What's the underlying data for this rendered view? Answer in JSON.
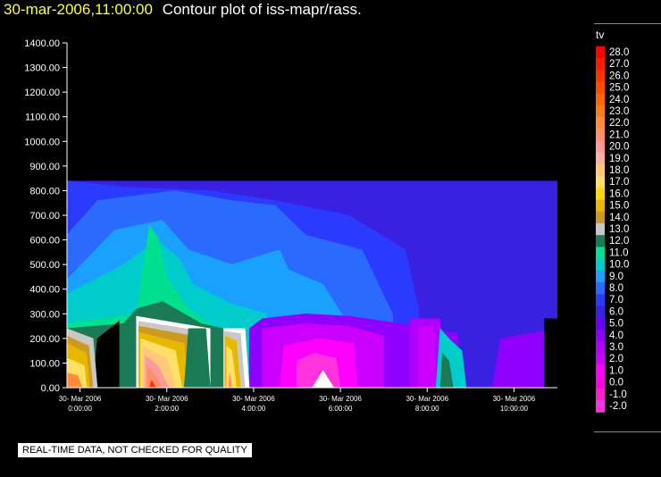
{
  "title": {
    "timestamp": "30-mar-2006,11:00:00",
    "text": "Contour plot of iss-mapr/rass."
  },
  "legend": {
    "title": "tv",
    "entries": [
      "28.0",
      "27.0",
      "26.0",
      "25.0",
      "24.0",
      "23.0",
      "22.0",
      "21.0",
      "20.0",
      "19.0",
      "18.0",
      "17.0",
      "16.0",
      "15.0",
      "14.0",
      "13.0",
      "12.0",
      "11.0",
      "10.0",
      "9.0",
      "8.0",
      "7.0",
      "6.0",
      "5.0",
      "4.0",
      "3.0",
      "2.0",
      "1.0",
      "0.0",
      "-1.0",
      "-2.0"
    ],
    "colors": [
      "#ff0000",
      "#ff1a00",
      "#ff3300",
      "#ff4d00",
      "#ff6600",
      "#ff7a1a",
      "#ff8c3a",
      "#ff8f6a",
      "#ff9a9a",
      "#ffb0a0",
      "#ffc87a",
      "#ffe066",
      "#ffd700",
      "#e8b800",
      "#cc9a22",
      "#c8c8c8",
      "#1a7a55",
      "#00e090",
      "#00cccc",
      "#1aa0ff",
      "#2a6aff",
      "#2a3aff",
      "#3a20e0",
      "#6600ff",
      "#9000ff",
      "#b000ff",
      "#cc00ff",
      "#ff00ff",
      "#ff00dd",
      "#ff22cc",
      "#ff33dd"
    ]
  },
  "note": "REAL-TIME DATA, NOT CHECKED FOR QUALITY",
  "chart_data": {
    "type": "heatmap",
    "title": "Contour plot of iss-mapr/rass.",
    "ylim": [
      0,
      1400
    ],
    "yticks": [
      "1400.00",
      "1300.00",
      "1200.00",
      "1100.00",
      "1000.00",
      "900.00",
      "800.00",
      "700.00",
      "600.00",
      "500.00",
      "400.00",
      "300.00",
      "200.00",
      "100.00",
      "0.00"
    ],
    "xlim": [
      -0.3,
      11.0
    ],
    "xticks": [
      {
        "hour": 0,
        "date": "30- Mar 2006",
        "time": "0:00:00"
      },
      {
        "hour": 2,
        "date": "30- Mar 2006",
        "time": "2:00:00"
      },
      {
        "hour": 4,
        "date": "30- Mar 2006",
        "time": "4:00:00"
      },
      {
        "hour": 6,
        "date": "30- Mar 2006",
        "time": "6:00:00"
      },
      {
        "hour": 8,
        "date": "30- Mar 2006",
        "time": "8:00:00"
      },
      {
        "hour": 10,
        "date": "30- Mar 2006",
        "time": "10:00:00"
      }
    ],
    "regions": [
      {
        "fill": "#3a20e0",
        "points": [
          [
            -0.3,
            0
          ],
          [
            11.5,
            0
          ],
          [
            11.5,
            840
          ],
          [
            -0.3,
            840
          ]
        ]
      },
      {
        "fill": "#2a3aff",
        "points": [
          [
            -0.3,
            0
          ],
          [
            8,
            0
          ],
          [
            7.8,
            320
          ],
          [
            7.5,
            560
          ],
          [
            6.2,
            700
          ],
          [
            4.5,
            760
          ],
          [
            3,
            800
          ],
          [
            1,
            815
          ],
          [
            -0.3,
            840
          ]
        ]
      },
      {
        "fill": "#2a6aff",
        "points": [
          [
            -0.3,
            0
          ],
          [
            7.3,
            0
          ],
          [
            7.2,
            300
          ],
          [
            6.5,
            560
          ],
          [
            5.2,
            620
          ],
          [
            4.5,
            740
          ],
          [
            3.5,
            760
          ],
          [
            2.2,
            800
          ],
          [
            0.4,
            760
          ],
          [
            -0.3,
            620
          ]
        ]
      },
      {
        "fill": "#1aa0ff",
        "points": [
          [
            -0.3,
            0
          ],
          [
            6.2,
            0
          ],
          [
            6.1,
            280
          ],
          [
            5.6,
            420
          ],
          [
            4.8,
            480
          ],
          [
            4.6,
            560
          ],
          [
            3.5,
            500
          ],
          [
            2.5,
            560
          ],
          [
            1.9,
            680
          ],
          [
            0.8,
            640
          ],
          [
            -0.3,
            440
          ]
        ]
      },
      {
        "fill": "#00cccc",
        "points": [
          [
            -0.3,
            0
          ],
          [
            4.4,
            0
          ],
          [
            4.3,
            300
          ],
          [
            3.5,
            340
          ],
          [
            2.6,
            420
          ],
          [
            2.3,
            520
          ],
          [
            1.8,
            600
          ],
          [
            1.0,
            500
          ],
          [
            -0.3,
            380
          ]
        ]
      },
      {
        "fill": "#00e090",
        "points": [
          [
            -0.3,
            0
          ],
          [
            3.4,
            0
          ],
          [
            3.3,
            220
          ],
          [
            2.5,
            320
          ],
          [
            2.0,
            450
          ],
          [
            1.8,
            610
          ],
          [
            1.6,
            660
          ],
          [
            1.5,
            540
          ],
          [
            1.3,
            300
          ],
          [
            -0.3,
            260
          ]
        ]
      },
      {
        "fill": "#1a7a55",
        "points": [
          [
            -0.3,
            0
          ],
          [
            3.9,
            0
          ],
          [
            3.8,
            220
          ],
          [
            2.8,
            260
          ],
          [
            1.9,
            350
          ],
          [
            1.3,
            320
          ],
          [
            1.0,
            260
          ],
          [
            -0.3,
            240
          ]
        ]
      },
      {
        "fill": "#9000ff",
        "points": [
          [
            3.9,
            0
          ],
          [
            8.8,
            0
          ],
          [
            8.7,
            220
          ],
          [
            7.4,
            260
          ],
          [
            6.2,
            290
          ],
          [
            5.2,
            300
          ],
          [
            4.2,
            280
          ],
          [
            3.9,
            240
          ]
        ]
      },
      {
        "fill": "#cc00ff",
        "points": [
          [
            4.2,
            0
          ],
          [
            7.0,
            0
          ],
          [
            7.0,
            210
          ],
          [
            6.2,
            250
          ],
          [
            5.2,
            260
          ],
          [
            4.2,
            240
          ]
        ]
      },
      {
        "fill": "#ff00ff",
        "points": [
          [
            4.6,
            0
          ],
          [
            6.4,
            0
          ],
          [
            6.3,
            180
          ],
          [
            5.5,
            200
          ],
          [
            4.7,
            170
          ]
        ]
      },
      {
        "fill": "#ff33dd",
        "points": [
          [
            5.0,
            0
          ],
          [
            6.0,
            0
          ],
          [
            5.9,
            120
          ],
          [
            5.4,
            140
          ],
          [
            5.0,
            110
          ]
        ]
      },
      {
        "fill": "#ffffff",
        "points": [
          [
            5.35,
            0
          ],
          [
            5.85,
            0
          ],
          [
            5.6,
            70
          ]
        ]
      },
      {
        "fill": "#b000ff",
        "points": [
          [
            7.6,
            0
          ],
          [
            8.4,
            0
          ],
          [
            8.3,
            280
          ],
          [
            7.6,
            280
          ]
        ]
      },
      {
        "fill": "#cc00ff",
        "points": [
          [
            7.8,
            0
          ],
          [
            8.2,
            0
          ],
          [
            8.15,
            250
          ],
          [
            7.8,
            250
          ]
        ]
      },
      {
        "fill": "#00cccc",
        "points": [
          [
            8.2,
            0
          ],
          [
            8.9,
            0
          ],
          [
            8.8,
            150
          ],
          [
            8.5,
            200
          ],
          [
            8.3,
            240
          ]
        ]
      },
      {
        "fill": "#1a7a55",
        "points": [
          [
            8.3,
            0
          ],
          [
            8.6,
            0
          ],
          [
            8.5,
            110
          ],
          [
            8.35,
            140
          ]
        ]
      },
      {
        "fill": "#9000ff",
        "points": [
          [
            9.5,
            0
          ],
          [
            10.7,
            0
          ],
          [
            10.7,
            230
          ],
          [
            9.7,
            200
          ]
        ]
      },
      {
        "fill": "#000000",
        "points": [
          [
            0.3,
            0
          ],
          [
            0.9,
            0
          ],
          [
            0.9,
            270
          ],
          [
            0.4,
            200
          ]
        ]
      },
      {
        "fill": "#c8c8c8",
        "points": [
          [
            -0.3,
            0
          ],
          [
            0.4,
            0
          ],
          [
            0.3,
            200
          ],
          [
            -0.3,
            240
          ]
        ]
      },
      {
        "fill": "#cc9a22",
        "points": [
          [
            -0.3,
            0
          ],
          [
            0.3,
            0
          ],
          [
            0.2,
            170
          ],
          [
            -0.3,
            210
          ]
        ]
      },
      {
        "fill": "#e8b800",
        "points": [
          [
            -0.3,
            0
          ],
          [
            0.22,
            0
          ],
          [
            0.15,
            140
          ],
          [
            -0.3,
            180
          ]
        ]
      },
      {
        "fill": "#ffe066",
        "points": [
          [
            -0.3,
            0
          ],
          [
            0.15,
            0
          ],
          [
            0.1,
            90
          ],
          [
            -0.3,
            120
          ]
        ]
      },
      {
        "fill": "#ff8c3a",
        "points": [
          [
            -0.3,
            0
          ],
          [
            0.05,
            0
          ],
          [
            -0.05,
            50
          ],
          [
            -0.3,
            60
          ]
        ]
      },
      {
        "fill": "#ffffff",
        "points": [
          [
            1.3,
            0
          ],
          [
            3.0,
            0
          ],
          [
            3.0,
            240
          ],
          [
            1.3,
            290
          ]
        ]
      },
      {
        "fill": "#c8c8c8",
        "points": [
          [
            1.35,
            0
          ],
          [
            2.8,
            0
          ],
          [
            2.8,
            230
          ],
          [
            1.35,
            270
          ]
        ]
      },
      {
        "fill": "#cc9a22",
        "points": [
          [
            1.35,
            0
          ],
          [
            2.6,
            0
          ],
          [
            2.6,
            210
          ],
          [
            1.35,
            250
          ]
        ]
      },
      {
        "fill": "#e8b800",
        "points": [
          [
            1.35,
            0
          ],
          [
            2.5,
            0
          ],
          [
            2.4,
            180
          ],
          [
            1.35,
            225
          ]
        ]
      },
      {
        "fill": "#ffe066",
        "points": [
          [
            1.4,
            0
          ],
          [
            2.35,
            0
          ],
          [
            2.2,
            150
          ],
          [
            1.4,
            200
          ]
        ]
      },
      {
        "fill": "#ffc87a",
        "points": [
          [
            1.45,
            0
          ],
          [
            2.2,
            0
          ],
          [
            2.0,
            120
          ],
          [
            1.45,
            170
          ]
        ]
      },
      {
        "fill": "#ff9a9a",
        "points": [
          [
            1.5,
            0
          ],
          [
            2.05,
            0
          ],
          [
            1.8,
            90
          ],
          [
            1.5,
            130
          ]
        ]
      },
      {
        "fill": "#ff8f6a",
        "points": [
          [
            1.55,
            0
          ],
          [
            1.9,
            0
          ],
          [
            1.7,
            60
          ],
          [
            1.55,
            90
          ]
        ]
      },
      {
        "fill": "#ff3300",
        "points": [
          [
            1.6,
            0
          ],
          [
            1.75,
            0
          ],
          [
            1.65,
            30
          ]
        ]
      },
      {
        "fill": "#1a7a55",
        "points": [
          [
            2.4,
            0
          ],
          [
            3.0,
            0
          ],
          [
            2.9,
            240
          ],
          [
            2.5,
            240
          ]
        ]
      },
      {
        "fill": "#ffffff",
        "points": [
          [
            3.3,
            0
          ],
          [
            3.9,
            0
          ],
          [
            3.8,
            240
          ],
          [
            3.3,
            240
          ]
        ]
      },
      {
        "fill": "#c8c8c8",
        "points": [
          [
            3.32,
            0
          ],
          [
            3.8,
            0
          ],
          [
            3.7,
            220
          ],
          [
            3.32,
            230
          ]
        ]
      },
      {
        "fill": "#e8b800",
        "points": [
          [
            3.35,
            0
          ],
          [
            3.7,
            0
          ],
          [
            3.6,
            190
          ],
          [
            3.35,
            210
          ]
        ]
      },
      {
        "fill": "#ffe066",
        "points": [
          [
            3.38,
            0
          ],
          [
            3.6,
            0
          ],
          [
            3.5,
            150
          ],
          [
            3.38,
            170
          ]
        ]
      },
      {
        "fill": "#ff8f6a",
        "points": [
          [
            3.42,
            0
          ],
          [
            3.5,
            0
          ],
          [
            3.45,
            60
          ]
        ]
      },
      {
        "fill": "#1a7a55",
        "points": [
          [
            3.15,
            0
          ],
          [
            3.3,
            0
          ],
          [
            3.3,
            240
          ],
          [
            3.15,
            220
          ]
        ]
      },
      {
        "fill": "#000000",
        "points": [
          [
            10.7,
            0
          ],
          [
            11.5,
            0
          ],
          [
            11.5,
            280
          ],
          [
            10.7,
            280
          ]
        ]
      }
    ]
  }
}
